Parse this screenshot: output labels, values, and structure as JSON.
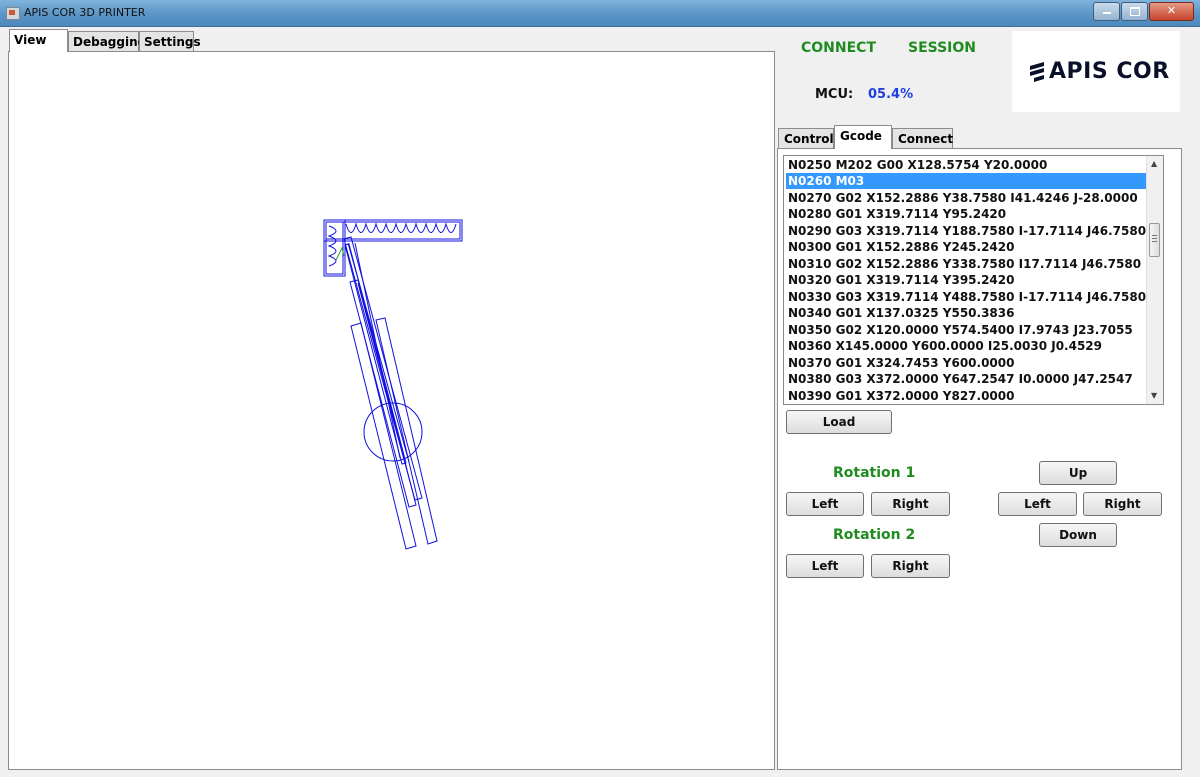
{
  "titlebar": {
    "title": "APIS COR 3D PRINTER"
  },
  "left_tabs": [
    {
      "label": "View",
      "active": true
    },
    {
      "label": "Debagging",
      "active": false
    },
    {
      "label": "Settings",
      "active": false
    }
  ],
  "header": {
    "connect_label": "CONNECT",
    "session_label": "SESSION",
    "mcu_label": "MCU:",
    "mcu_value": "05.4%",
    "logo_text": "APIS COR"
  },
  "right_tabs": [
    {
      "label": "Control",
      "active": false
    },
    {
      "label": "Gcode",
      "active": true
    },
    {
      "label": "Connect",
      "active": false
    }
  ],
  "gcode": {
    "lines": [
      "N0250 M202 G00 X128.5754 Y20.0000",
      "N0260 M03",
      "N0270 G02 X152.2886 Y38.7580 I41.4246 J-28.0000",
      "N0280 G01 X319.7114 Y95.2420",
      "N0290 G03 X319.7114 Y188.7580 I-17.7114 J46.7580",
      "N0300 G01 X152.2886 Y245.2420",
      "N0310 G02 X152.2886 Y338.7580 I17.7114 J46.7580",
      "N0320 G01 X319.7114 Y395.2420",
      "N0330 G03 X319.7114 Y488.7580 I-17.7114 J46.7580",
      "N0340 G01 X137.0325 Y550.3836",
      "N0350 G02 X120.0000 Y574.5400 I7.9743 J23.7055",
      "N0360 X145.0000 Y600.0000 I25.0030 J0.4529",
      "N0370 G01 X324.7453 Y600.0000",
      "N0380 G03 X372.0000 Y647.2547 I0.0000 J47.2547",
      "N0390 G01 X372.0000 Y827.0000"
    ],
    "selected_index": 1,
    "load_label": "Load"
  },
  "controls": {
    "rotation1_label": "Rotation 1",
    "rotation2_label": "Rotation 2",
    "rot1_left": "Left",
    "rot1_right": "Right",
    "rot2_left": "Left",
    "rot2_right": "Right",
    "up_label": "Up",
    "down_label": "Down",
    "move_left": "Left",
    "move_right": "Right"
  },
  "colors": {
    "accent_green": "#1f8c1f",
    "mcu_blue": "#1f3fe0",
    "drawing_blue": "#1010e0",
    "selection": "#3399ff"
  }
}
